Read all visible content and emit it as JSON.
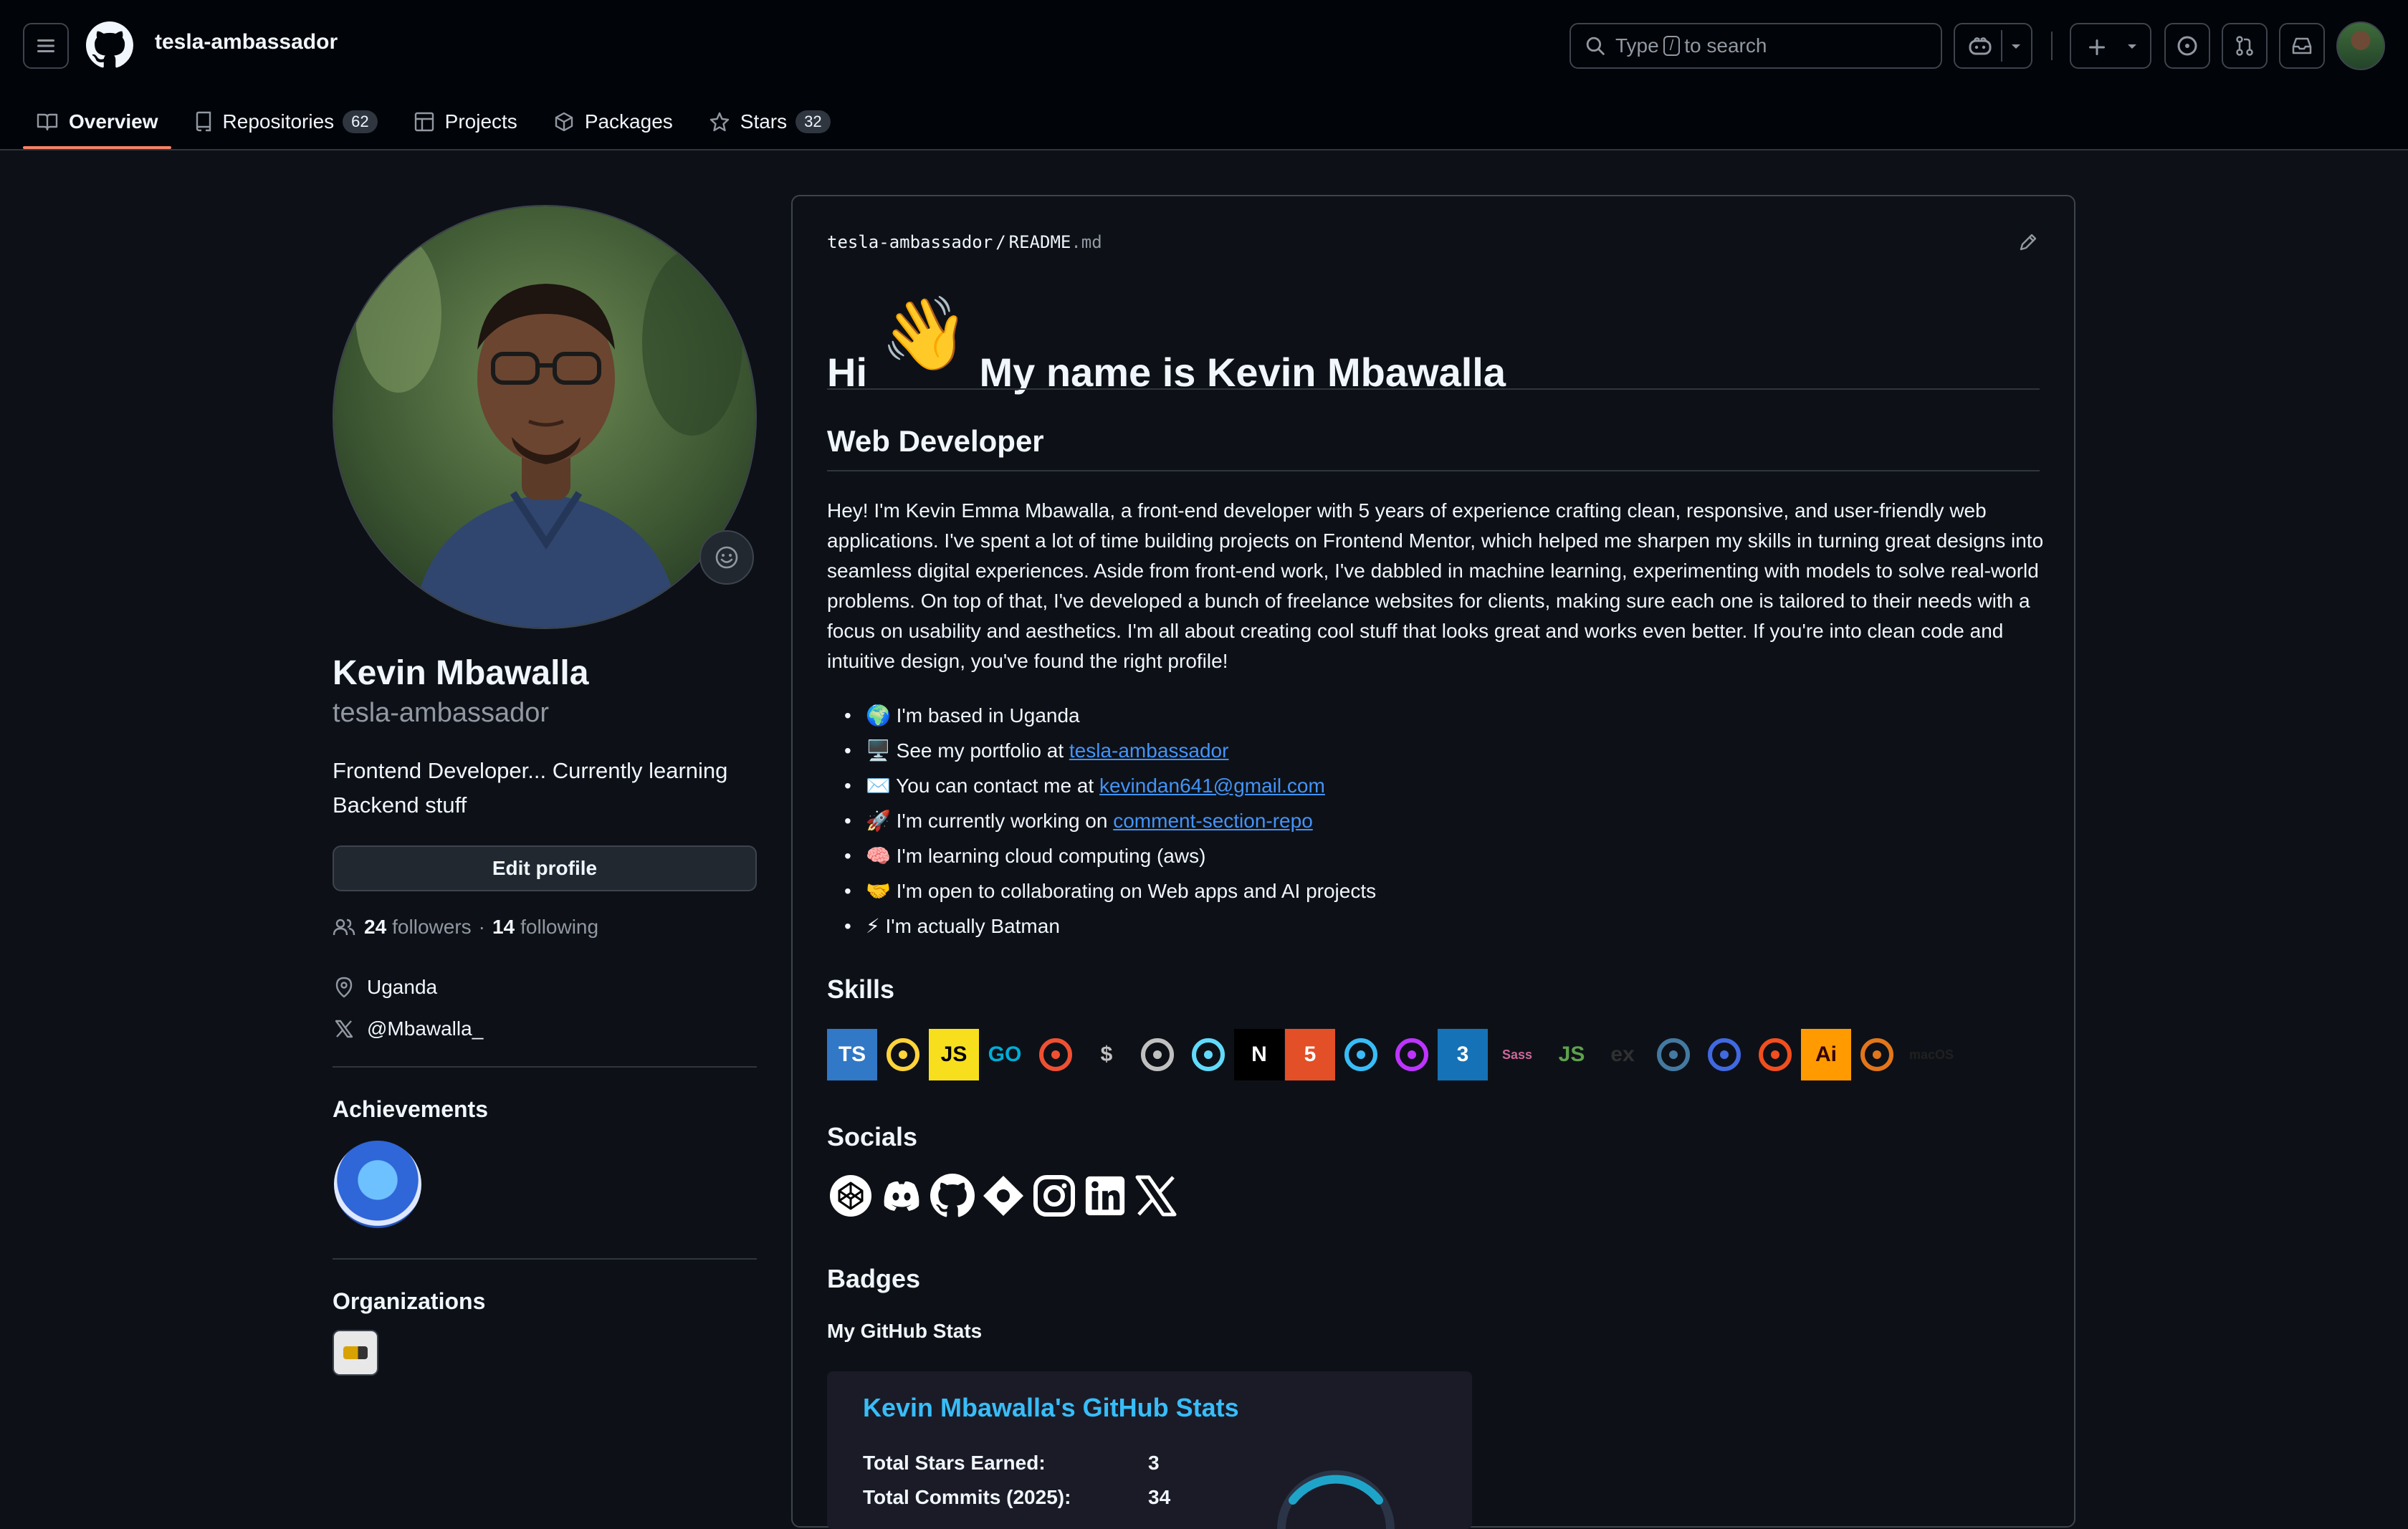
{
  "header": {
    "username": "tesla-ambassador",
    "search_placeholder_pre": "Type",
    "search_key": "/",
    "search_placeholder_post": "to search"
  },
  "tabs": [
    {
      "label": "Overview",
      "count": null
    },
    {
      "label": "Repositories",
      "count": "62"
    },
    {
      "label": "Projects",
      "count": null
    },
    {
      "label": "Packages",
      "count": null
    },
    {
      "label": "Stars",
      "count": "32"
    }
  ],
  "profile": {
    "name": "Kevin Mbawalla",
    "login": "tesla-ambassador",
    "bio": "Frontend Developer... Currently learning Backend stuff",
    "edit_label": "Edit profile",
    "followers_count": "24",
    "followers_label": "followers",
    "separator": "·",
    "following_count": "14",
    "following_label": "following",
    "location": "Uganda",
    "twitter": "@Mbawalla_",
    "achievements_title": "Achievements",
    "organizations_title": "Organizations"
  },
  "readme": {
    "path_owner": "tesla-ambassador",
    "path_sep": "/",
    "path_file": "README",
    "path_ext": ".md",
    "heading_hi": "Hi",
    "heading_wave": "👋",
    "heading_rest": "My name is Kevin Mbawalla",
    "subtitle": "Web Developer",
    "intro": "Hey! I'm Kevin Emma Mbawalla, a front-end developer with 5 years of experience crafting clean, responsive, and user-friendly web applications. I've spent a lot of time building projects on Frontend Mentor, which helped me sharpen my skills in turning great designs into seamless digital experiences. Aside from front-end work, I've dabbled in machine learning, experimenting with models to solve real-world problems. On top of that, I've developed a bunch of freelance websites for clients, making sure each one is tailored to their needs with a focus on usability and aesthetics. I'm all about creating cool stuff that looks great and works even better. If you're into clean code and intuitive design, you've found the right profile!",
    "items": [
      {
        "emoji": "🌍",
        "text": "I'm based in Uganda",
        "link": ""
      },
      {
        "emoji": "🖥️",
        "text": "See my portfolio at",
        "link": "tesla-ambassador"
      },
      {
        "emoji": "✉️",
        "text": "You can contact me at",
        "link": "kevindan641@gmail.com"
      },
      {
        "emoji": "🚀",
        "text": "I'm currently working on",
        "link": "comment-section-repo"
      },
      {
        "emoji": "🧠",
        "text": "I'm learning cloud computing (aws)",
        "link": ""
      },
      {
        "emoji": "🤝",
        "text": "I'm open to collaborating on Web apps and AI projects",
        "link": ""
      },
      {
        "emoji": "⚡",
        "text": "I'm actually Batman",
        "link": ""
      }
    ],
    "skills_title": "Skills",
    "skill_icons": [
      {
        "name": "typescript-icon",
        "label": "TS",
        "bg": "#3178c6",
        "fg": "#ffffff"
      },
      {
        "name": "python-icon",
        "label": "",
        "bg": "transparent",
        "fg": "#ffd43b"
      },
      {
        "name": "javascript-icon",
        "label": "JS",
        "bg": "#f7df1e",
        "fg": "#000000"
      },
      {
        "name": "go-icon",
        "label": "GO",
        "bg": "transparent",
        "fg": "#00add8"
      },
      {
        "name": "git-icon",
        "label": "",
        "bg": "transparent",
        "fg": "#f05032"
      },
      {
        "name": "bash-icon",
        "label": "$",
        "bg": "transparent",
        "fg": "#c0c0c0"
      },
      {
        "name": "vscode-icon",
        "label": "",
        "bg": "transparent",
        "fg": "#c0c0c0"
      },
      {
        "name": "react-icon",
        "label": "",
        "bg": "transparent",
        "fg": "#61dafb"
      },
      {
        "name": "nextjs-icon",
        "label": "N",
        "bg": "#000000",
        "fg": "#ffffff"
      },
      {
        "name": "html5-icon",
        "label": "5",
        "bg": "#e34f26",
        "fg": "#ffffff"
      },
      {
        "name": "tailwind-icon",
        "label": "",
        "bg": "transparent",
        "fg": "#38bdf8"
      },
      {
        "name": "vite-icon",
        "label": "",
        "bg": "transparent",
        "fg": "#bd34fe"
      },
      {
        "name": "css3-icon",
        "label": "3",
        "bg": "#1572b6",
        "fg": "#ffffff"
      },
      {
        "name": "sass-icon",
        "label": "Sass",
        "bg": "transparent",
        "fg": "#cd6799"
      },
      {
        "name": "nodejs-icon",
        "label": "JS",
        "bg": "transparent",
        "fg": "#5fa04e"
      },
      {
        "name": "express-icon",
        "label": "ex",
        "bg": "transparent",
        "fg": "#303030"
      },
      {
        "name": "mysql-icon",
        "label": "",
        "bg": "transparent",
        "fg": "#4479a1"
      },
      {
        "name": "postgresql-icon",
        "label": "",
        "bg": "transparent",
        "fg": "#4169e1"
      },
      {
        "name": "figma-icon",
        "label": "",
        "bg": "transparent",
        "fg": "#f24e1e"
      },
      {
        "name": "illustrator-icon",
        "label": "Ai",
        "bg": "#ff9a00",
        "fg": "#330000"
      },
      {
        "name": "metamask-icon",
        "label": "",
        "bg": "transparent",
        "fg": "#e2761b"
      },
      {
        "name": "macos-icon",
        "label": "macOS",
        "bg": "transparent",
        "fg": "#202020"
      }
    ],
    "socials_title": "Socials",
    "social_icons": [
      "codepen-icon",
      "discord-icon",
      "github-icon",
      "devto-icon",
      "instagram-icon",
      "linkedin-icon",
      "x-icon"
    ],
    "badges_title": "Badges",
    "stats_title": "My GitHub Stats"
  },
  "stats_card": {
    "title": "Kevin Mbawalla's GitHub Stats",
    "rows": [
      {
        "label": "Total Stars Earned:",
        "value": "3"
      },
      {
        "label": "Total Commits (2025):",
        "value": "34"
      }
    ]
  },
  "colors": {
    "bg": "#0d1117",
    "header_bg": "#010409",
    "accent_tab": "#f78166",
    "link": "#4493f8",
    "muted": "#9198a1",
    "stats_title": "#38bdf8"
  }
}
